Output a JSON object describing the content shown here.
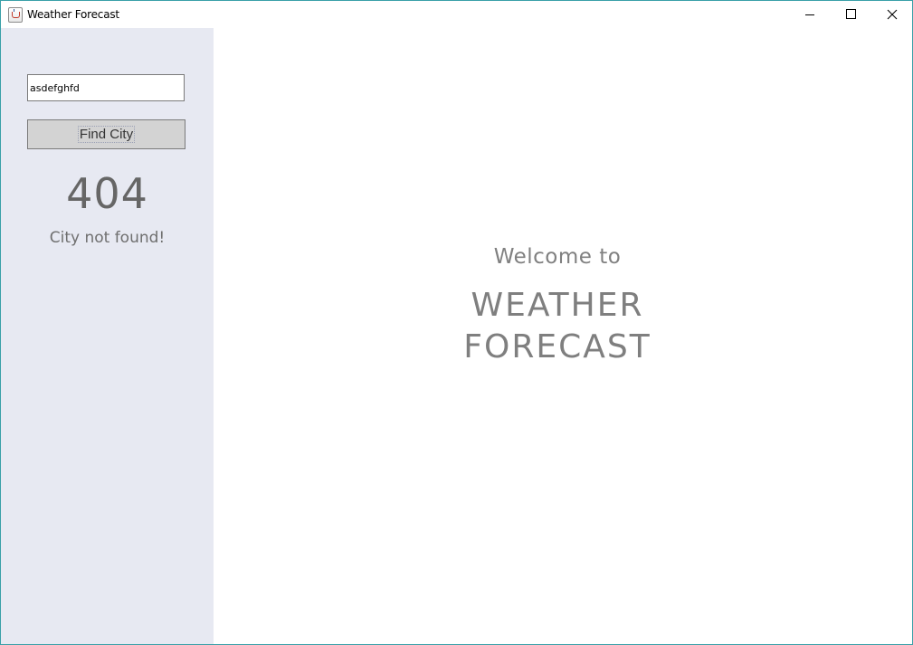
{
  "window": {
    "title": "Weather Forecast",
    "border_color": "#3aa0a8"
  },
  "titlebar": {
    "icons": {
      "app": "java-cup-icon",
      "minimize": "minimize-icon",
      "maximize": "maximize-icon",
      "close": "close-icon"
    }
  },
  "sidebar": {
    "background": "#e7e9f2",
    "search": {
      "value": "asdefghfd"
    },
    "find_button_label": "Find City",
    "error_code": "404",
    "error_message": "City not found!"
  },
  "main": {
    "welcome_text": "Welcome to",
    "brand_line1": "WEATHER",
    "brand_line2": "FORECAST"
  }
}
